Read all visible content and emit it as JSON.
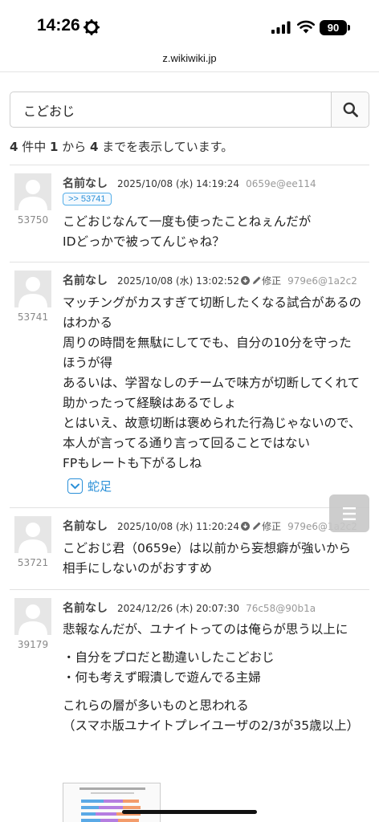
{
  "status": {
    "time": "14:26",
    "battery": "90"
  },
  "browser": {
    "url": "z.wikiwiki.jp"
  },
  "search": {
    "value": "こどおじ",
    "placeholder": ""
  },
  "summary": {
    "total": "4",
    "t1": " 件中 ",
    "from": "1",
    "t2": " から ",
    "to": "4",
    "t3": " までを表示しています。"
  },
  "posts": [
    {
      "no": "53750",
      "name": "名前なし",
      "date": "2025/10/08 (水) 14:19:24",
      "id": "0659e@ee114",
      "anchor": ">> 53741",
      "lines": [
        "こどおじなんて一度も使ったことねぇんだが",
        "IDどっかで被ってんじゃね？"
      ]
    },
    {
      "no": "53741",
      "name": "名前なし",
      "date": "2025/10/08 (水) 13:02:52",
      "edit": "修正",
      "id": "979e6@1a2c2",
      "lines": [
        "マッチングがカスすぎて切断したくなる試合があるのはわかる",
        "周りの時間を無駄にしてでも、自分の10分を守ったほうが得",
        "あるいは、学習なしのチームで味方が切断してくれて助かったって経験はあるでしょ",
        "とはいえ、故意切断は褒められた行為じゃないので、本人が言ってる通り言って回ることではない",
        "FPもレートも下がるしね"
      ],
      "footnote": "蛇足"
    },
    {
      "no": "53721",
      "name": "名前なし",
      "date": "2025/10/08 (水) 11:20:24",
      "edit": "修正",
      "id": "979e6@1a2c2",
      "lines": [
        "こどおじ君（0659e）は以前から妄想癖が強いから相手にしないのがおすすめ"
      ]
    },
    {
      "no": "39179",
      "name": "名前なし",
      "date": "2024/12/26 (木) 20:07:30",
      "id": "76c58@90b1a",
      "lines": [
        "悲報なんだが、ユナイトってのは俺らが思う以上に"
      ],
      "list": [
        "・自分をプロだと勘違いしたこどおじ",
        "・何も考えず暇潰しで遊んでる主婦"
      ],
      "lines2": [
        "これらの層が多いものと思われる",
        "（スマホ版ユナイトプレイユーザの2/3が35歳以上）"
      ]
    }
  ],
  "icons": {
    "status": [
      "gear-icon",
      "signal-icon",
      "wifi-icon"
    ],
    "search": "magnifier-icon",
    "menu": "hamburger-icon"
  },
  "colors": {
    "link": "#2b90d8",
    "id_text": "#999999",
    "border": "#e2e2e2"
  }
}
